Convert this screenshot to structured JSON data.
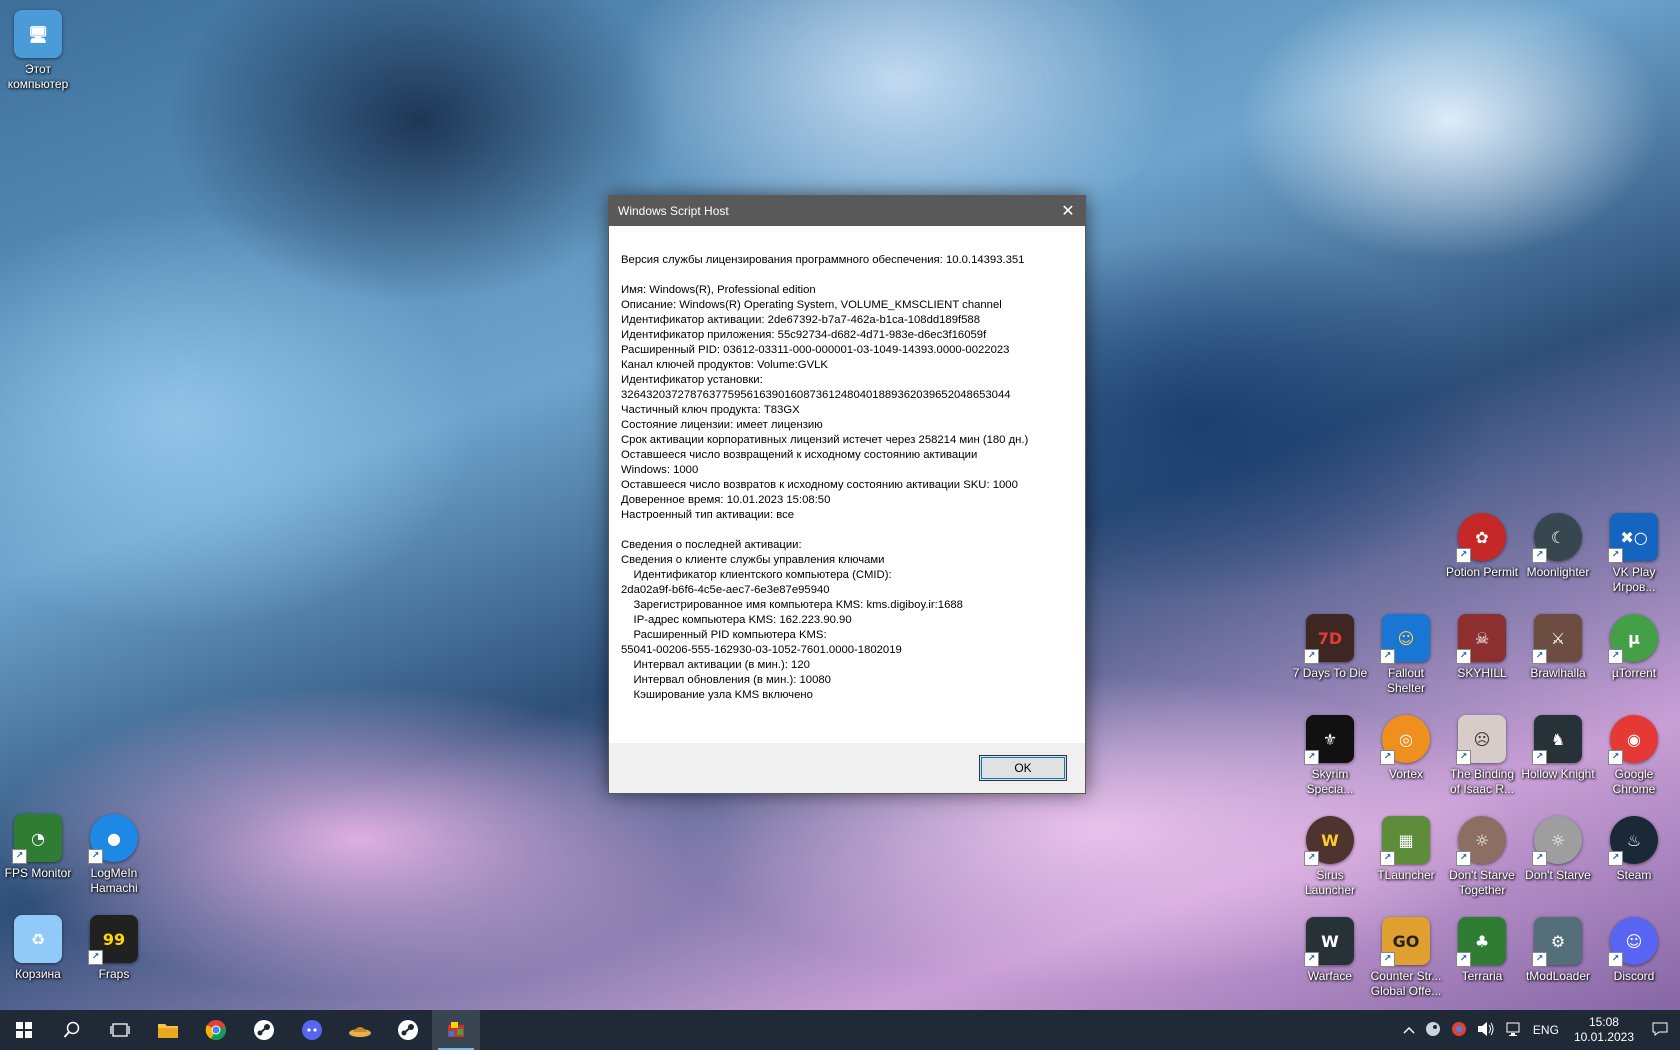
{
  "dialog": {
    "title": "Windows Script Host",
    "lines": [
      "Версия службы лицензирования программного обеспечения: 10.0.14393.351",
      "",
      "Имя: Windows(R), Professional edition",
      "Описание: Windows(R) Operating System, VOLUME_KMSCLIENT channel",
      "Идентификатор активации: 2de67392-b7a7-462a-b1ca-108dd189f588",
      "Идентификатор приложения: 55c92734-d682-4d71-983e-d6ec3f16059f",
      "Расширенный PID: 03612-03311-000-000001-03-1049-14393.0000-0022023",
      "Канал ключей продуктов: Volume:GVLK",
      "Идентификатор установки:",
      "32643203727876377595616390160873612480401889362039652048653044",
      "Частичный ключ продукта: T83GX",
      "Состояние лицензии: имеет лицензию",
      "Срок активации корпоративных лицензий истечет через 258214 мин (180 дн.)",
      "Оставшееся число возвращений к исходному состоянию активации",
      "Windows: 1000",
      "Оставшееся число возвратов к исходному состоянию активации SKU: 1000",
      "Доверенное время: 10.01.2023 15:08:50",
      "Настроенный тип активации: все",
      "",
      "Сведения о последней активации:",
      "Сведения о клиенте службы управления ключами",
      "    Идентификатор клиентского компьютера (CMID):",
      "2da02a9f-b6f6-4c5e-aec7-6e3e87e95940",
      "    Зарегистрированное имя компьютера KMS: kms.digiboy.ir:1688",
      "    IP-адрес компьютера KMS: 162.223.90.90",
      "    Расширенный PID компьютера KMS:",
      "55041-00206-555-162930-03-1052-7601.0000-1802019",
      "    Интервал активации (в мин.): 120",
      "    Интервал обновления (в мин.): 10080",
      "    Кэширование узла KMS включено"
    ],
    "ok_label": "OK",
    "close_glyph": "✕"
  },
  "desktop_icons": [
    {
      "id": "this-pc",
      "label": "Этот компьютер",
      "glyph": "🖥",
      "color": "#4a9bd8"
    },
    {
      "id": "fps-monitor",
      "label": "FPS Monitor",
      "glyph": "◔",
      "color": "#2e7d32"
    },
    {
      "id": "hamachi",
      "label": "LogMeIn Hamachi",
      "glyph": "●",
      "color": "#1e88e5"
    },
    {
      "id": "recycle-bin",
      "label": "Корзина",
      "glyph": "♻",
      "color": "#90caf9"
    },
    {
      "id": "fraps",
      "label": "Fraps",
      "glyph": "99",
      "color": "#212121"
    },
    {
      "id": "potion-permit",
      "label": "Potion Permit",
      "glyph": "✿",
      "color": "#c62828"
    },
    {
      "id": "moonlighter",
      "label": "Moonlighter",
      "glyph": "☾",
      "color": "#37474f"
    },
    {
      "id": "vk-play",
      "label": "VK Play Игров...",
      "glyph": "✖○",
      "color": "#1565c0"
    },
    {
      "id": "7-days",
      "label": "7 Days To Die",
      "glyph": "7D",
      "color": "#3e2723"
    },
    {
      "id": "fallout-shelter",
      "label": "Fallout Shelter",
      "glyph": "☺",
      "color": "#1976d2"
    },
    {
      "id": "skyhill",
      "label": "SKYHILL",
      "glyph": "☠",
      "color": "#8d2f2f"
    },
    {
      "id": "brawlhalla",
      "label": "Brawlhalla",
      "glyph": "⚔",
      "color": "#6d4c41"
    },
    {
      "id": "utorrent",
      "label": "µTorrent",
      "glyph": "µ",
      "color": "#43a047"
    },
    {
      "id": "skyrim",
      "label": "Skyrim Specia...",
      "glyph": "⚜",
      "color": "#111111"
    },
    {
      "id": "vortex",
      "label": "Vortex",
      "glyph": "◎",
      "color": "#ef8f1e"
    },
    {
      "id": "binding-of-isaac",
      "label": "The Binding of Isaac R...",
      "glyph": "☹",
      "color": "#d7ccc8"
    },
    {
      "id": "hollow-knight",
      "label": "Hollow Knight",
      "glyph": "♞",
      "color": "#263238"
    },
    {
      "id": "google-chrome",
      "label": "Google Chrome",
      "glyph": "◉",
      "color": "#e53935"
    },
    {
      "id": "sirus",
      "label": "Sirus Launcher",
      "glyph": "W",
      "color": "#4e342e"
    },
    {
      "id": "tlauncher",
      "label": "TLauncher",
      "glyph": "▦",
      "color": "#5d8c3a"
    },
    {
      "id": "dont-starve-together",
      "label": "Don't Starve Together",
      "glyph": "☼",
      "color": "#8d6e63"
    },
    {
      "id": "dont-starve",
      "label": "Don't Starve",
      "glyph": "☼",
      "color": "#9e9e9e"
    },
    {
      "id": "steam",
      "label": "Steam",
      "glyph": "♨",
      "color": "#1b2838"
    },
    {
      "id": "warface",
      "label": "Warface",
      "glyph": "W",
      "color": "#263238"
    },
    {
      "id": "counter-strike",
      "label": "Counter Str... Global Offe...",
      "glyph": "GO",
      "color": "#e0a030"
    },
    {
      "id": "terraria",
      "label": "Terraria",
      "glyph": "♣",
      "color": "#2e7d32"
    },
    {
      "id": "tmodloader",
      "label": "tModLoader",
      "glyph": "⚙",
      "color": "#546e7a"
    },
    {
      "id": "discord",
      "label": "Discord",
      "glyph": "☺",
      "color": "#5865f2"
    }
  ],
  "taskbar": {
    "buttons": [
      {
        "id": "start",
        "glyph": "⊞"
      },
      {
        "id": "search",
        "glyph": "⌕"
      },
      {
        "id": "task-view",
        "glyph": "❐"
      },
      {
        "id": "file-explorer",
        "glyph": "📁"
      },
      {
        "id": "chrome",
        "glyph": "◉"
      },
      {
        "id": "steam",
        "glyph": "♨"
      },
      {
        "id": "discord",
        "glyph": "☺"
      },
      {
        "id": "app-hat",
        "glyph": "⌒"
      },
      {
        "id": "steam-2",
        "glyph": "♨"
      },
      {
        "id": "script-host",
        "glyph": "▣"
      }
    ],
    "language": "ENG",
    "time": "15:08",
    "date": "10.01.2023"
  }
}
